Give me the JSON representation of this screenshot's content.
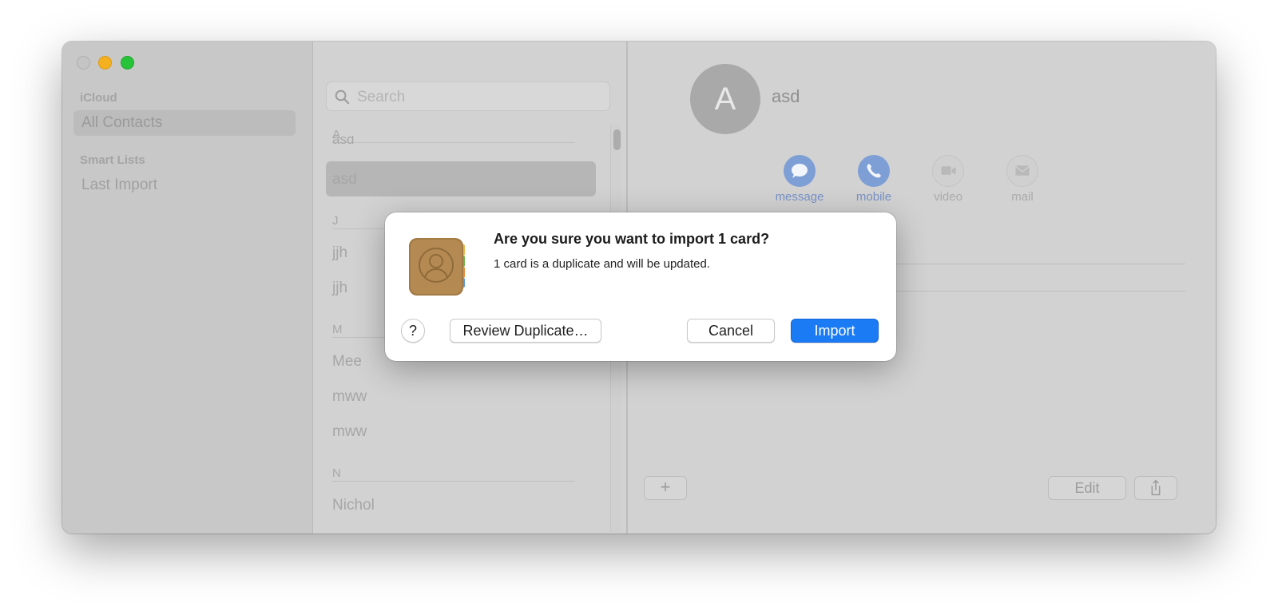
{
  "sidebar": {
    "section_icloud": "iCloud",
    "all_contacts": "All Contacts",
    "section_smart": "Smart Lists",
    "last_import": "Last Import"
  },
  "list": {
    "search_placeholder": "Search",
    "groups": [
      {
        "letter": "A",
        "contacts": [
          "asd",
          "asd"
        ]
      },
      {
        "letter": "J",
        "contacts": [
          "jjh",
          "jjh"
        ]
      },
      {
        "letter": "M",
        "contacts": [
          "Mee",
          "mww",
          "mww"
        ]
      },
      {
        "letter": "N",
        "contacts": [
          "Nichol"
        ]
      }
    ]
  },
  "detail": {
    "avatar_initial": "A",
    "name": "asd",
    "actions": [
      {
        "label": "message",
        "icon": "message-icon",
        "active": true
      },
      {
        "label": "mobile",
        "icon": "phone-icon",
        "active": true
      },
      {
        "label": "video",
        "icon": "video-icon",
        "active": false
      },
      {
        "label": "mail",
        "icon": "mail-icon",
        "active": false
      }
    ],
    "add_label": "+",
    "edit_label": "Edit"
  },
  "dialog": {
    "title": "Are you sure you want to import 1 card?",
    "message": "1 card is a duplicate and will be updated.",
    "help_label": "?",
    "review_label": "Review Duplicate…",
    "cancel_label": "Cancel",
    "import_label": "Import"
  },
  "colors": {
    "accent": "#1a7bf4",
    "action_blue": "#7e9ed6"
  }
}
